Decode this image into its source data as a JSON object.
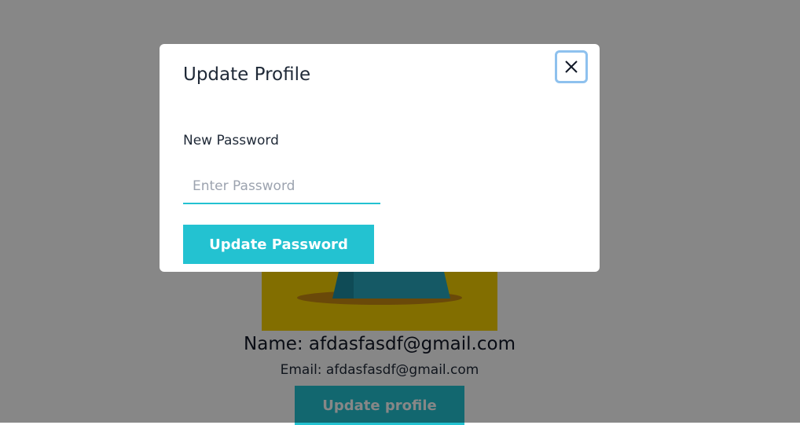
{
  "profile": {
    "name_text": "Name: afdasfasdf@gmail.com",
    "email_text": "Email: afdasfasdf@gmail.com",
    "update_button_label": "Update profile"
  },
  "modal": {
    "title": "Update Profile",
    "close_icon": "close-icon",
    "password_label": "New Password",
    "password_placeholder": "Enter Password",
    "password_value": "",
    "submit_label": "Update Password"
  },
  "colors": {
    "accent": "#23c2d1",
    "overlay": "rgba(0,0,0,0.47)",
    "focus_ring": "#8ec1ee",
    "image_bg": "#f5d000"
  }
}
